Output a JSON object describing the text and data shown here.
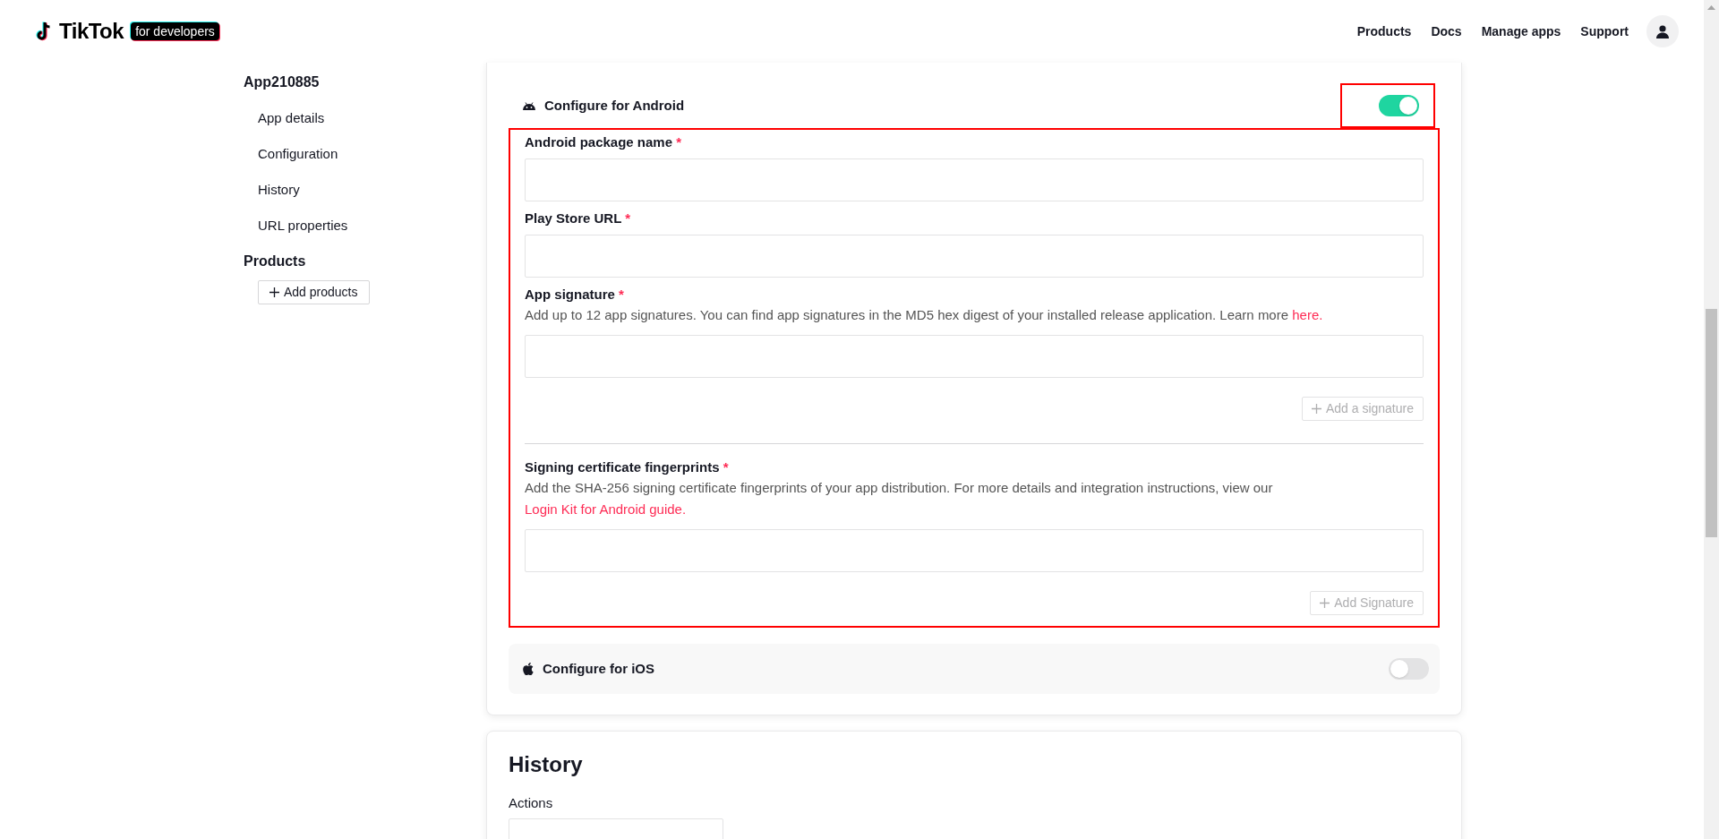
{
  "header": {
    "logo": {
      "wordmark": "TikTok",
      "badge": "for developers"
    },
    "nav": [
      {
        "label": "Products"
      },
      {
        "label": "Docs"
      },
      {
        "label": "Manage apps"
      },
      {
        "label": "Support"
      }
    ]
  },
  "sidebar": {
    "app_name": "App210885",
    "items": [
      {
        "label": "App details"
      },
      {
        "label": "Configuration"
      },
      {
        "label": "History"
      },
      {
        "label": "URL properties"
      }
    ],
    "section": "Products",
    "add_button": "Add products"
  },
  "android": {
    "title": "Configure for Android",
    "on": true,
    "toggle_highlighted": true,
    "fields_highlighted": true,
    "fields": [
      {
        "label": "Android package name",
        "required_mark": "*"
      },
      {
        "label": "Play Store URL",
        "required_mark": "*"
      },
      {
        "label": "App signature",
        "required_mark": "*",
        "description": "Add up to 12 app signatures. You can find app signatures in the MD5 hex digest of your installed release application. Learn more",
        "link": "here.",
        "add_button": "Add a signature"
      },
      {
        "label": "Signing certificate fingerprints",
        "required_mark": "*",
        "description": "Add the SHA-256 signing certificate fingerprints of your app distribution. For more details and integration instructions, view our",
        "link": "Login Kit for Android guide.",
        "add_button": "Add Signature"
      }
    ]
  },
  "ios": {
    "title": "Configure for iOS",
    "on": false
  },
  "history": {
    "title": "History",
    "actions_label": "Actions"
  }
}
